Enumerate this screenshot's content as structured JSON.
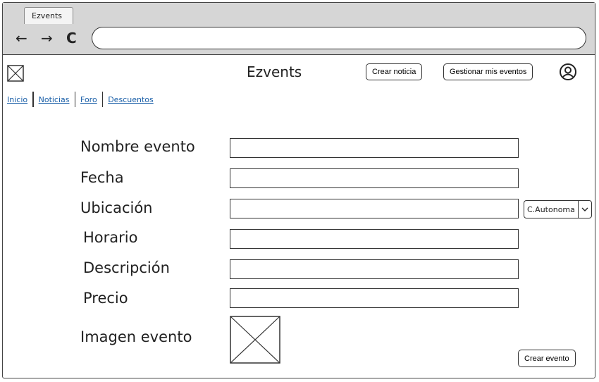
{
  "browser": {
    "tab_title": "Ezvents",
    "back_icon": "←",
    "forward_icon": "→",
    "reload_icon": "C",
    "url": ""
  },
  "header": {
    "title": "Ezvents",
    "crear_noticia": "Crear noticia",
    "gestionar": "Gestionar mis eventos"
  },
  "nav": {
    "items": [
      "Inicio",
      "Noticias",
      "Foro",
      "Descuentos"
    ]
  },
  "form": {
    "nombre_label": "Nombre evento",
    "fecha_label": "Fecha",
    "ubicacion_label": "Ubicación",
    "horario_label": "Horario",
    "descripcion_label": "Descripción",
    "precio_label": "Precio",
    "imagen_label": "Imagen evento",
    "region_select": "C.Autonoma",
    "submit": "Crear evento"
  },
  "colors": {
    "link": "#1a5fa8",
    "chrome": "#d6d6d6"
  }
}
